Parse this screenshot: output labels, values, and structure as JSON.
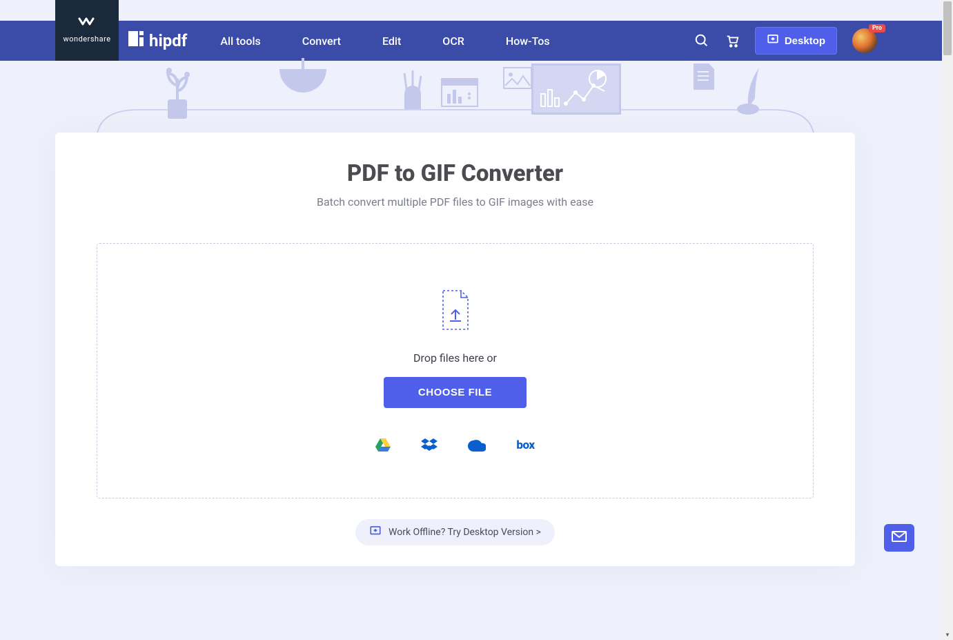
{
  "brand": {
    "parent": "wondershare",
    "product": "hipdf"
  },
  "nav": {
    "all_tools": "All tools",
    "convert": "Convert",
    "edit": "Edit",
    "ocr": "OCR",
    "howtos": "How-Tos"
  },
  "header": {
    "desktop_label": "Desktop",
    "pro_badge": "Pro"
  },
  "main": {
    "title": "PDF to GIF Converter",
    "subtitle": "Batch convert multiple PDF files to GIF images with ease",
    "drop_text": "Drop files here or",
    "choose_file": "CHOOSE FILE",
    "offline_text": "Work Offline? Try Desktop Version >"
  },
  "cloud_sources": {
    "gdrive": "google-drive",
    "dropbox": "dropbox",
    "onedrive": "onedrive",
    "box": "box"
  }
}
